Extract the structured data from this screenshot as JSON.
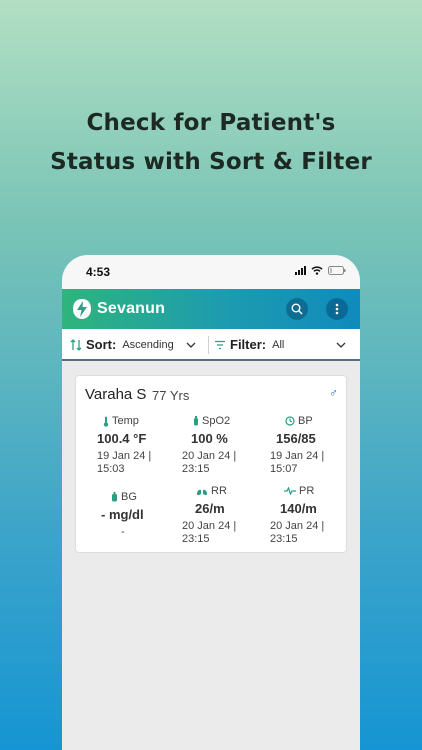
{
  "headline": {
    "line1": "Check for Patient's",
    "line2": "Status with Sort & Filter"
  },
  "statusbar": {
    "time": "4:53"
  },
  "appbar": {
    "brand": "Sevanun",
    "colors": {
      "start": "#2fb47c",
      "end": "#0f8bbd"
    },
    "icons": [
      "logo-icon",
      "search-icon",
      "more-vert-icon"
    ]
  },
  "toolbar": {
    "sort_label": "Sort:",
    "sort_value": "Ascending",
    "filter_label": "Filter:",
    "filter_value": "All"
  },
  "patient": {
    "name": "Varaha S",
    "age": "77 Yrs",
    "gender_icon": "♂",
    "vitals": [
      {
        "label": "Temp",
        "icon": "thermometer-icon",
        "value": "100.4 °F",
        "time1": "19 Jan 24 |",
        "time2": "15:03"
      },
      {
        "label": "SpO2",
        "icon": "oxygen-icon",
        "value": "100 %",
        "time1": "20 Jan 24 |",
        "time2": "23:15"
      },
      {
        "label": "BP",
        "icon": "gauge-icon",
        "value": "156/85",
        "time1": "19 Jan 24 |",
        "time2": "15:07"
      },
      {
        "label": "BG",
        "icon": "blood-drop-icon",
        "value": "- mg/dl",
        "time1": "-",
        "time2": ""
      },
      {
        "label": "RR",
        "icon": "lungs-icon",
        "value": "26/m",
        "time1": "20 Jan 24 |",
        "time2": "23:15"
      },
      {
        "label": "PR",
        "icon": "pulse-icon",
        "value": "140/m",
        "time1": "20 Jan 24 |",
        "time2": "23:15"
      }
    ]
  }
}
